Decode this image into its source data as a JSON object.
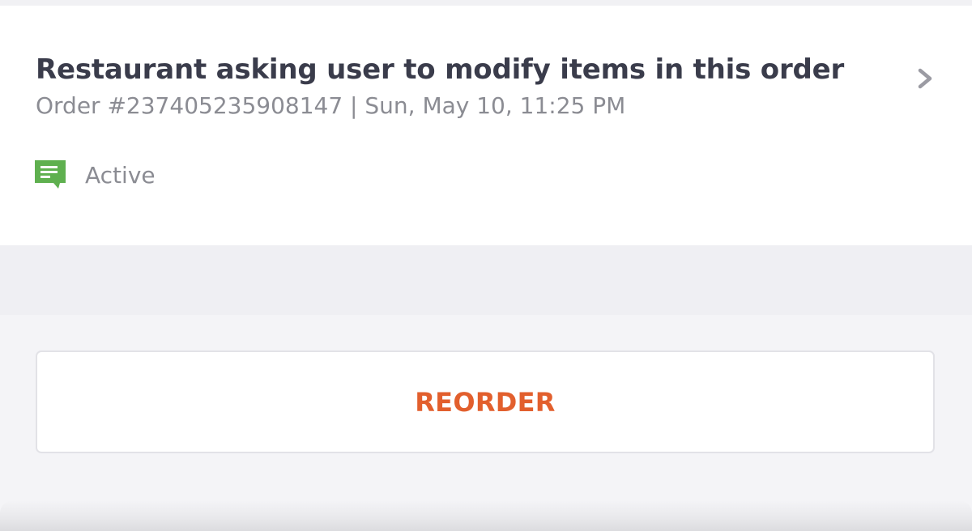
{
  "order": {
    "title": "Restaurant asking user to modify items in this order",
    "meta": "Order #237405235908147 | Sun, May 10, 11:25 PM",
    "status_label": "Active",
    "status_icon": "chat-message-icon",
    "detail_icon": "chevron-right-icon"
  },
  "actions": {
    "reorder_label": "REORDER"
  },
  "colors": {
    "accent": "#e25f2d",
    "status_green": "#5fb04f",
    "title_text": "#3a3c4b",
    "secondary_text": "#8b8c93",
    "background": "#f4f4f7"
  }
}
